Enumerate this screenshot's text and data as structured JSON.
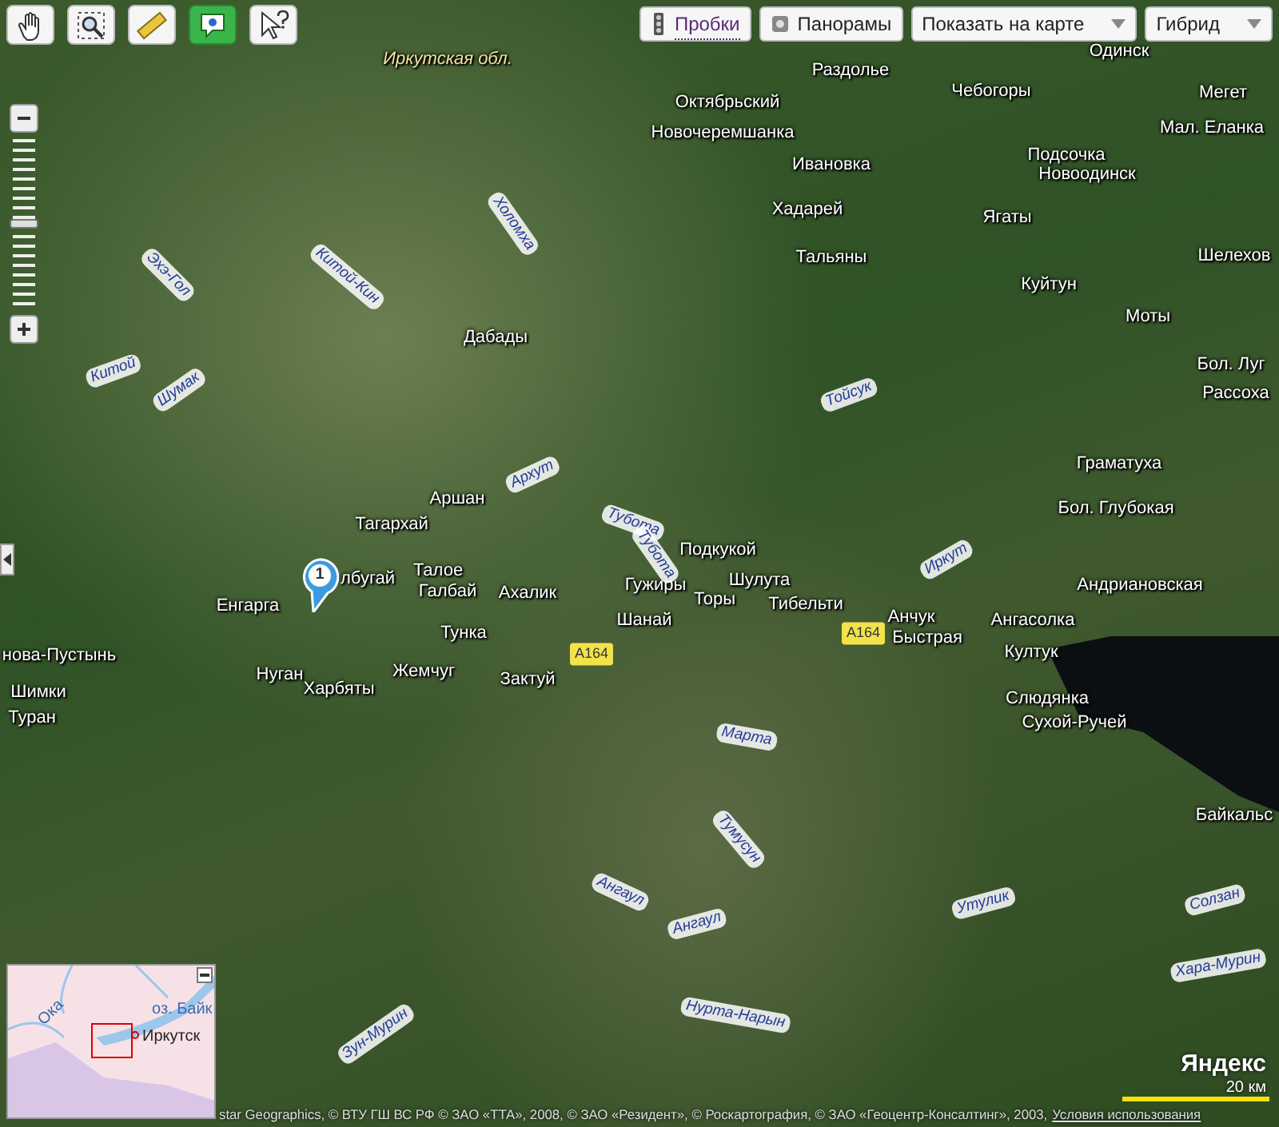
{
  "tools": [
    {
      "kind": "hand",
      "selected": false
    },
    {
      "kind": "zoom",
      "selected": false
    },
    {
      "kind": "ruler",
      "selected": false
    },
    {
      "kind": "marker",
      "selected": true
    },
    {
      "kind": "help",
      "selected": false
    }
  ],
  "zoom_slider": {
    "level": 0.5
  },
  "top_controls": [
    {
      "kind": "traffic",
      "label": "Пробки"
    },
    {
      "kind": "panorama",
      "label": "Панорамы"
    },
    {
      "kind": "dropdown",
      "label": "Показать на карте"
    },
    {
      "kind": "dropdown",
      "label": "Гибрид"
    }
  ],
  "places": [
    "Иркутская обл.",
    "Раздолье",
    "Одинск",
    "Октябрьский",
    "Чебогоры",
    "Мегет",
    "Новочеремшанка",
    "Мал. Еланка",
    "Ивановка",
    "Подсочка",
    "Новоодинск",
    "Хадарей",
    "Ягаты",
    "Шелехов",
    "Тальяны",
    "Куйтун",
    "Дабады",
    "Моты",
    "Бол. Луг",
    "Рассоха",
    "Граматуха",
    "Аршан",
    "Тагархай",
    "Бол. Глубокая",
    "Подкукой",
    "Талое",
    "лбугай",
    "Галбай",
    "Ахалик",
    "Гужиры",
    "Торы",
    "Шулута",
    "Андриановская",
    "Енгарга",
    "Тибельти",
    "Анчук",
    "Ангасолка",
    "Тунка",
    "Шанай",
    "Быстрая",
    "Култук",
    "нова-Пустынь",
    "Нуган",
    "Жемчуг",
    "Зактуй",
    "Харбяты",
    "Шимки",
    "Слюдянка",
    "Сухой-Ручей",
    "Туран",
    "Байкальс"
  ],
  "roads": [
    "А164",
    "А164"
  ],
  "rivers": [
    "Архут",
    "Тубота",
    "Тубота",
    "Иркут",
    "Холомха",
    "Китой",
    "Шумак",
    "Эхэ-Гол",
    "Китой-Кин",
    "Марта",
    "Тумусун",
    "Ангаул",
    "Ангаул",
    "Утулик",
    "Хара-Мурин",
    "Нурта-Нарын",
    "Зун-Мурин",
    "Солзан",
    "Тойсук"
  ],
  "marker": {
    "label": "1"
  },
  "minimap": {
    "labels": [
      "Ока",
      "оз. Байк",
      "Иркутск"
    ]
  },
  "logo": "Яндекс",
  "scale": "20 км",
  "copyright": "star Geographics, © ВТУ ГШ ВС РФ © ЗАО «ТТА», 2008, © ЗАО «Резидент», © Роскартография, © ЗАО «Геоцентр-Консалтинг», 2003,",
  "terms_link": "Условия использования"
}
